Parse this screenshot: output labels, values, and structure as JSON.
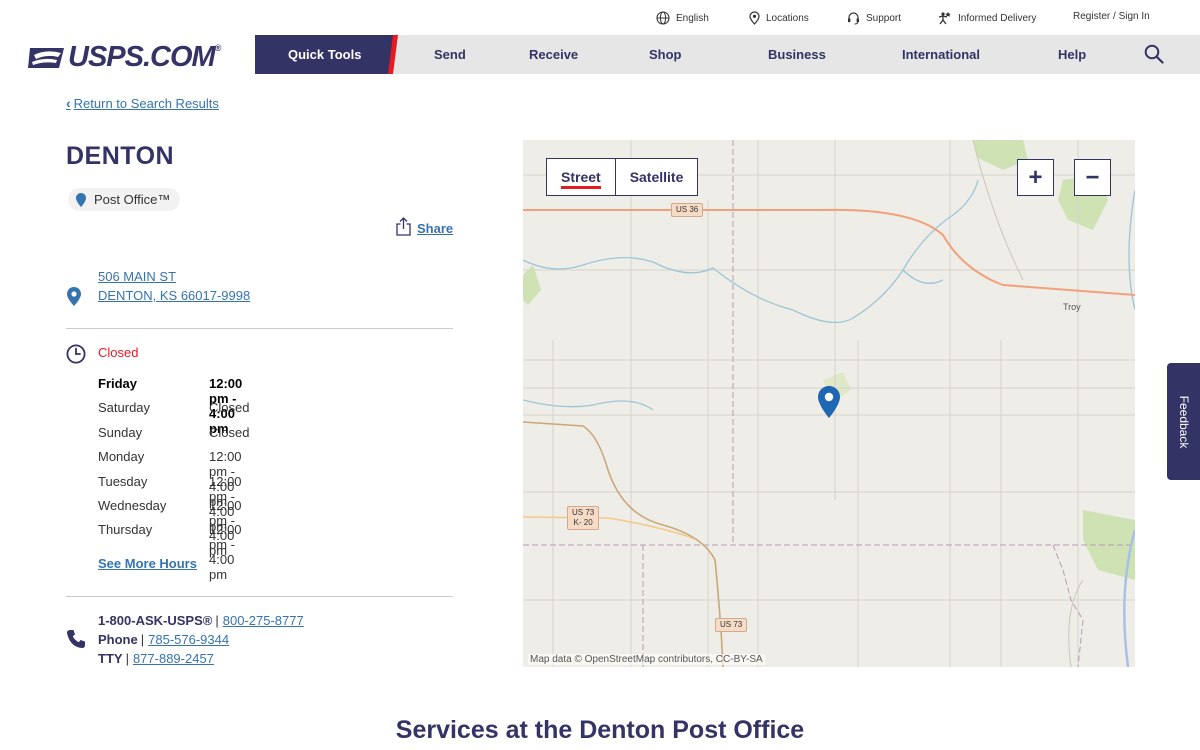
{
  "utility": {
    "english": "English",
    "locations": "Locations",
    "support": "Support",
    "informed_delivery": "Informed Delivery",
    "register": "Register / Sign In"
  },
  "logo": {
    "text": "USPS.COM",
    "mark": "®"
  },
  "nav": {
    "quick_tools": "Quick Tools",
    "items": [
      "Send",
      "Receive",
      "Shop",
      "Business",
      "International",
      "Help"
    ]
  },
  "back_link": "Return to Search Results",
  "location": {
    "name": "DENTON",
    "type": "Post Office™",
    "address_line1": "506 MAIN ST",
    "address_line2": "DENTON, KS 66017-9998"
  },
  "share_label": "Share",
  "status": "Closed",
  "hours": [
    {
      "day": "Friday",
      "time": "12:00 pm - 4:00 pm"
    },
    {
      "day": "Saturday",
      "time": "Closed"
    },
    {
      "day": "Sunday",
      "time": "Closed"
    },
    {
      "day": "Monday",
      "time": "12:00 pm - 4:00 pm"
    },
    {
      "day": "Tuesday",
      "time": "12:00 pm - 4:00 pm"
    },
    {
      "day": "Wednesday",
      "time": "12:00 pm - 4:00 pm"
    },
    {
      "day": "Thursday",
      "time": "12:00 pm - 4:00 pm"
    }
  ],
  "see_more": "See More Hours",
  "contact": {
    "main_label": "1-800-ASK-USPS®",
    "main_number": "800-275-8777",
    "phone_label": "Phone",
    "phone_number": "785-576-9344",
    "tty_label": "TTY",
    "tty_number": "877-889-2457",
    "separator": "|"
  },
  "map": {
    "street_label": "Street",
    "satellite_label": "Satellite",
    "zoom_in": "+",
    "zoom_out": "−",
    "attribution": "Map data © OpenStreetMap contributors, CC-BY-SA",
    "shields": {
      "us36": "US 36",
      "us73_k20_a": "US 73",
      "us73_k20_b": "K- 20",
      "us73": "US 73"
    },
    "town": "Troy"
  },
  "feedback": "Feedback",
  "services_heading": "Services at the Denton Post Office",
  "colors": {
    "navy": "#333366",
    "red": "#e71921",
    "link": "#3573b1",
    "nav_bg": "#e6e6e6"
  }
}
